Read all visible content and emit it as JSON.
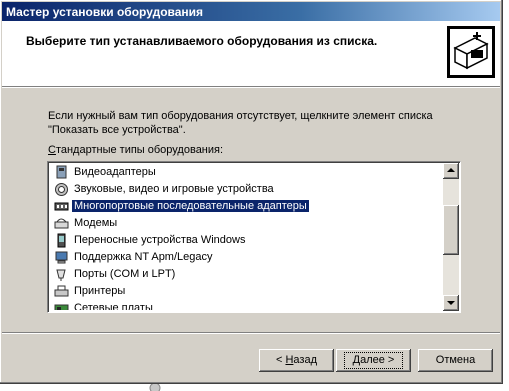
{
  "window": {
    "title": "Мастер установки оборудования"
  },
  "header": {
    "title": "Выберите тип устанавливаемого оборудования из списка."
  },
  "body": {
    "description": "Если нужный вам тип оборудования отсутствует, щелкните элемент списка \"Показать все устройства\".",
    "list_label_underlined": "С",
    "list_label_rest": "тандартные типы оборудования:"
  },
  "list": {
    "items": [
      {
        "label": "Видеоадаптеры",
        "icon": "display-adapter-icon",
        "selected": false
      },
      {
        "label": "Звуковые, видео и игровые устройства",
        "icon": "speaker-icon",
        "selected": false
      },
      {
        "label": "Многопортовые последовательные адаптеры",
        "icon": "serial-adapter-icon",
        "selected": true
      },
      {
        "label": "Модемы",
        "icon": "modem-icon",
        "selected": false
      },
      {
        "label": "Переносные устройства Windows",
        "icon": "portable-device-icon",
        "selected": false
      },
      {
        "label": "Поддержка NT Apm/Legacy",
        "icon": "computer-icon",
        "selected": false
      },
      {
        "label": "Порты (COM и LPT)",
        "icon": "port-icon",
        "selected": false
      },
      {
        "label": "Принтеры",
        "icon": "printer-icon",
        "selected": false
      },
      {
        "label": "Сетевые платы",
        "icon": "network-card-icon",
        "selected": false
      }
    ]
  },
  "buttons": {
    "back_underlined": "Н",
    "back_rest": "азад",
    "back_prefix": "< ",
    "next_underlined": "Д",
    "next_rest": "алее >",
    "cancel": "Отмена"
  },
  "colors": {
    "title_bar_start": "#0a246a",
    "title_bar_end": "#a6caf0",
    "selection": "#0a246a",
    "dialog_face": "#d4d0c8"
  }
}
